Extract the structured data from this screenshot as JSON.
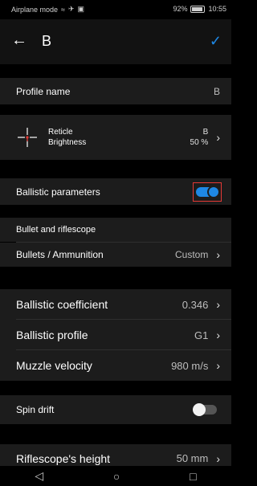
{
  "status": {
    "mode": "Airplane mode",
    "battery": "92%",
    "battery_level": 0.92,
    "time": "10:55"
  },
  "header": {
    "title": "B"
  },
  "profile": {
    "label": "Profile name",
    "value": "B"
  },
  "reticle": {
    "line1": "Reticle",
    "line2": "Brightness",
    "value1": "B",
    "value2": "50 %"
  },
  "ballistic": {
    "label": "Ballistic parameters",
    "enabled": true
  },
  "section": {
    "title": "Bullet and riflescope"
  },
  "bullets": {
    "label": "Bullets / Ammunition",
    "value": "Custom"
  },
  "coef": {
    "label": "Ballistic coefficient",
    "value": "0.346"
  },
  "bprofile": {
    "label": "Ballistic profile",
    "value": "G1"
  },
  "muzzle": {
    "label": "Muzzle velocity",
    "value": "980 m/s"
  },
  "spin": {
    "label": "Spin drift",
    "enabled": false
  },
  "scope": {
    "label": "Riflescope's height",
    "value": "50 mm"
  },
  "colors": {
    "accent": "#1e88e5",
    "highlight": "#e53935"
  }
}
